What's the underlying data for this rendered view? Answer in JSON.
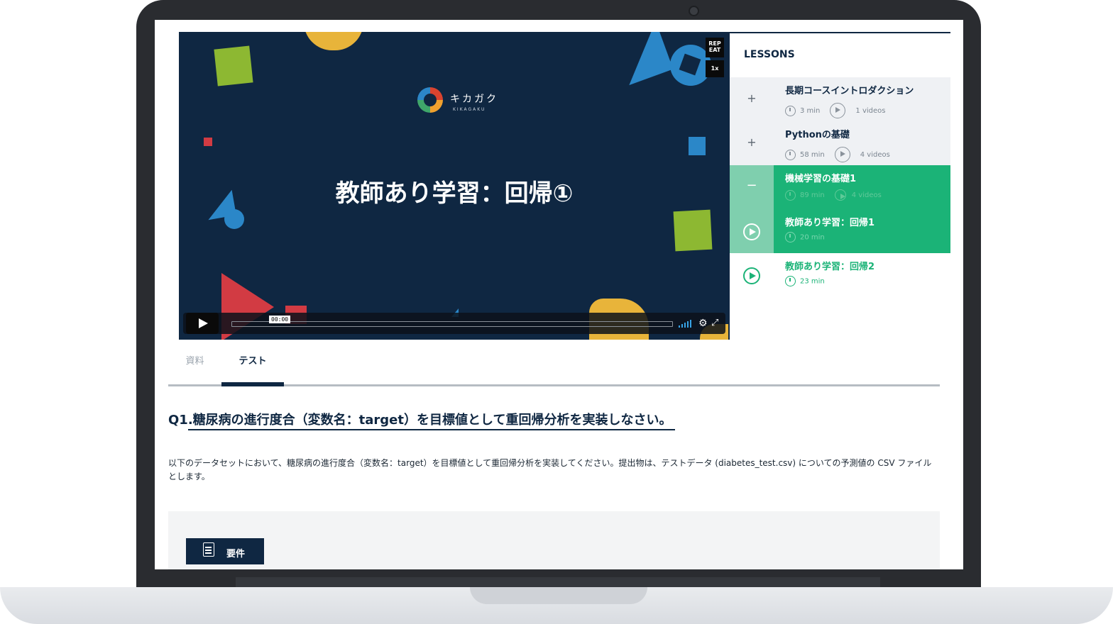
{
  "video": {
    "logo_text": "キカガク",
    "logo_sub": "KIKAGAKU",
    "slide_title": "教師あり学習：回帰①",
    "repeat_label_1": "REP",
    "repeat_label_2": "EAT",
    "speed_label": "1x",
    "time_tooltip": "00:00",
    "progress": 0.0
  },
  "lessons": {
    "title": "LESSONS",
    "items": [
      {
        "name": "長期コースイントロダクション",
        "duration": "3 min",
        "videos": "1 videos",
        "state": "collapsed",
        "toggle": "+"
      },
      {
        "name": "Pythonの基礎",
        "duration": "58 min",
        "videos": "4 videos",
        "state": "collapsed",
        "toggle": "+"
      },
      {
        "name": "機械学習の基礎1",
        "duration": "89 min",
        "videos": "4 videos",
        "state": "expanded",
        "toggle": "−"
      }
    ],
    "sub_items": [
      {
        "name": "教師あり学習：回帰1",
        "duration": "20 min",
        "state": "playing"
      },
      {
        "name": "教師あり学習：回帰2",
        "duration": "23 min",
        "state": "upcoming"
      }
    ]
  },
  "tabs": [
    {
      "label": "資料",
      "active": false
    },
    {
      "label": "テスト",
      "active": true
    }
  ],
  "question": {
    "title": "Q1.糖尿病の進行度合（変数名：target）を目標値として重回帰分析を実装しなさい。",
    "description": "以下のデータセットにおいて、糖尿病の進行度合（変数名：target）を目標値として重回帰分析を実装してください。提出物は、テストデータ (diabetes_test.csv) についての予測値の CSV ファイルとします。"
  },
  "requirements": {
    "button_label": "要件"
  },
  "colors": {
    "navy": "#0f2742",
    "green": "#1bb377",
    "light_green": "#7fcfae",
    "panel_gray": "#eff1f4"
  }
}
